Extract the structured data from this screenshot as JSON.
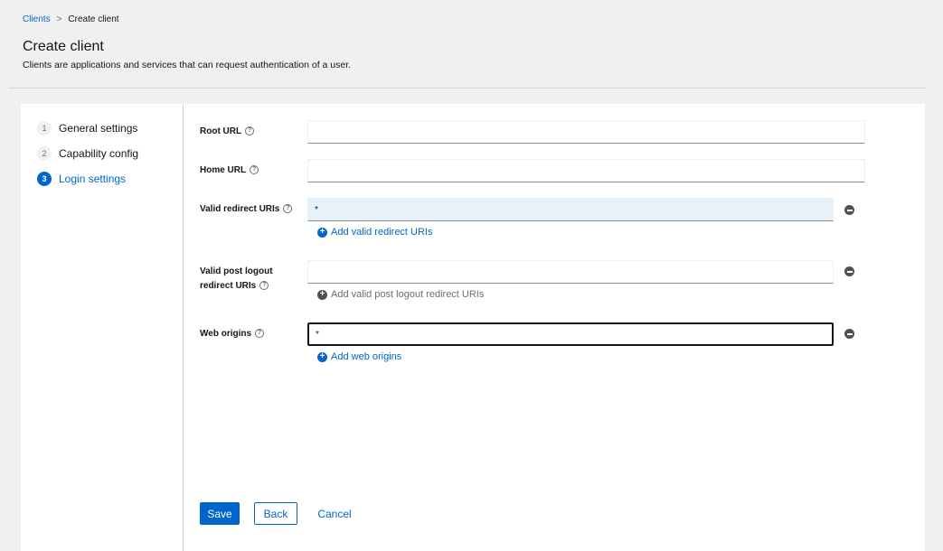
{
  "breadcrumb": {
    "parent": "Clients",
    "separator": ">",
    "current": "Create client"
  },
  "header": {
    "title": "Create client",
    "description": "Clients are applications and services that can request authentication of a user."
  },
  "wizard": {
    "steps": [
      {
        "number": "1",
        "label": "General settings",
        "active": false
      },
      {
        "number": "2",
        "label": "Capability config",
        "active": false
      },
      {
        "number": "3",
        "label": "Login settings",
        "active": true
      }
    ]
  },
  "form": {
    "help_glyph": "?",
    "root_url": {
      "label": "Root URL",
      "value": ""
    },
    "home_url": {
      "label": "Home URL",
      "value": ""
    },
    "valid_redirect_uris": {
      "label": "Valid redirect URIs",
      "value": "*",
      "add_label": "Add valid redirect URIs"
    },
    "valid_post_logout": {
      "label_line1": "Valid post logout",
      "label_line2": "redirect URIs",
      "value": "",
      "add_label": "Add valid post logout redirect URIs"
    },
    "web_origins": {
      "label": "Web origins",
      "value": "*",
      "add_label": "Add web origins"
    }
  },
  "actions": {
    "save": "Save",
    "back": "Back",
    "cancel": "Cancel"
  },
  "colors": {
    "accent": "#0066cc",
    "header_bg": "#f0f0f0",
    "filled_input_bg": "#e7f1fa"
  }
}
